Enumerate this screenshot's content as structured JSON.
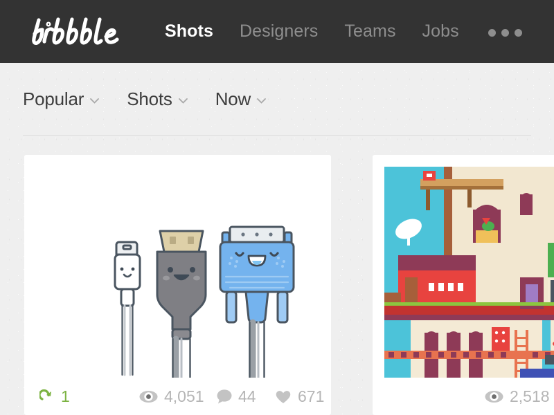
{
  "site": {
    "logo_text": "dribbble",
    "logo_name": "dribbble-wordmark"
  },
  "header": {
    "nav": [
      {
        "label": "Shots",
        "active": true,
        "name": "nav-shots"
      },
      {
        "label": "Designers",
        "active": false,
        "name": "nav-designers"
      },
      {
        "label": "Teams",
        "active": false,
        "name": "nav-teams"
      },
      {
        "label": "Jobs",
        "active": false,
        "name": "nav-jobs"
      }
    ],
    "more_label": "more-menu",
    "background": "#333333",
    "active_color": "#ffffff",
    "inactive_color": "#8e8e8e"
  },
  "filters": [
    {
      "label": "Popular",
      "icon": "chevron-down-icon",
      "name": "filter-sort"
    },
    {
      "label": "Shots",
      "icon": "chevron-down-icon",
      "name": "filter-type"
    },
    {
      "label": "Now",
      "icon": "chevron-down-icon",
      "name": "filter-time"
    }
  ],
  "shots": [
    {
      "name": "shot-card-cables",
      "illustration": "three-cartoon-cable-connectors",
      "stats": {
        "rebounds": {
          "icon": "rebound-icon",
          "value": "1",
          "color": "#7cb342"
        },
        "views": {
          "icon": "eye-icon",
          "value": "4,051"
        },
        "comments": {
          "icon": "comment-icon",
          "value": "44"
        },
        "likes": {
          "icon": "heart-icon",
          "value": "671"
        }
      }
    },
    {
      "name": "shot-card-city",
      "illustration": "flat-pixel-city-scene",
      "stats": {
        "views": {
          "icon": "eye-icon",
          "value": "2,518"
        }
      }
    }
  ],
  "colors": {
    "page_background": "#efefef",
    "card_background": "#ffffff",
    "stat_gray": "#b5b5b5",
    "divider": "#dcdcdc",
    "connector_blue": "#74b3ee",
    "connector_gray": "#7f7f84",
    "connector_tan": "#ded0a8",
    "city_sky": "#4cc3d9"
  }
}
